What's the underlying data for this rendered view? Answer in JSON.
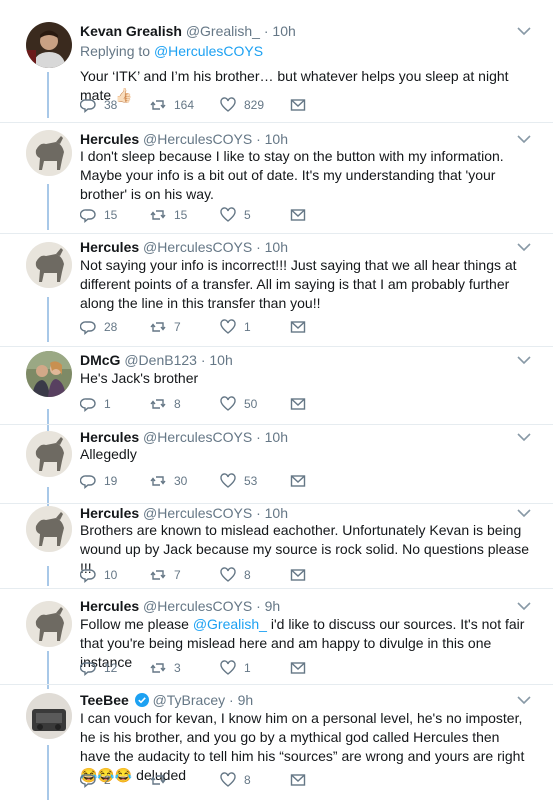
{
  "tweets": [
    {
      "name": "Kevan Grealish",
      "handle": "@Grealish_",
      "time": "10h",
      "replying_prefix": "Replying to ",
      "replying_to": "@HerculesCOYS",
      "text": "Your ‘ITK’ and I’m his brother… but whatever helps you sleep at night mate 👍🏻",
      "replies": "38",
      "retweets": "164",
      "likes": "829"
    },
    {
      "name": "Hercules",
      "handle": "@HerculesCOYS",
      "time": "10h",
      "text": "I don't sleep because I like to stay on the button with my information. Maybe your info is a bit out of date. It's my understanding that 'your brother' is on his way.",
      "replies": "15",
      "retweets": "15",
      "likes": "5"
    },
    {
      "name": "Hercules",
      "handle": "@HerculesCOYS",
      "time": "10h",
      "text": "Not saying your info is incorrect!!! Just saying that we all hear things at different points of a transfer. All im saying is that I am probably further along the line in this transfer than you!!",
      "replies": "28",
      "retweets": "7",
      "likes": "1"
    },
    {
      "name": "DMcG",
      "handle": "@DenB123",
      "time": "10h",
      "text": "He's Jack's brother",
      "replies": "1",
      "retweets": "8",
      "likes": "50"
    },
    {
      "name": "Hercules",
      "handle": "@HerculesCOYS",
      "time": "10h",
      "text": "Allegedly",
      "replies": "19",
      "retweets": "30",
      "likes": "53"
    },
    {
      "name": "Hercules",
      "handle": "@HerculesCOYS",
      "time": "10h",
      "text": "Brothers are known to mislead eachother. Unfortunately Kevan is being wound up by Jack because my source is rock solid. No questions please !!!",
      "replies": "10",
      "retweets": "7",
      "likes": "8"
    },
    {
      "name": "Hercules",
      "handle": "@HerculesCOYS",
      "time": "9h",
      "text_before": "Follow me please ",
      "mention": "@Grealish_",
      "text_after": " i'd like to discuss our sources. It's not fair that you're being mislead here and am happy to divulge in this one instance",
      "replies": "12",
      "retweets": "3",
      "likes": "1"
    },
    {
      "name": "TeeBee",
      "handle": "@TyBracey",
      "time": "9h",
      "text": "I can vouch for kevan, I know him on a personal level, he's no imposter, he is his brother, and you go by a mythical god called Hercules then have the audacity to tell him his “sources” are wrong and yours are right 😂😂😂 deluded",
      "replies": "2",
      "retweets": "",
      "likes": "8"
    }
  ],
  "separator_dot": "·",
  "colors": {
    "link": "#1da1f2",
    "thread_line": "#a8c8e8",
    "muted": "#657786"
  }
}
